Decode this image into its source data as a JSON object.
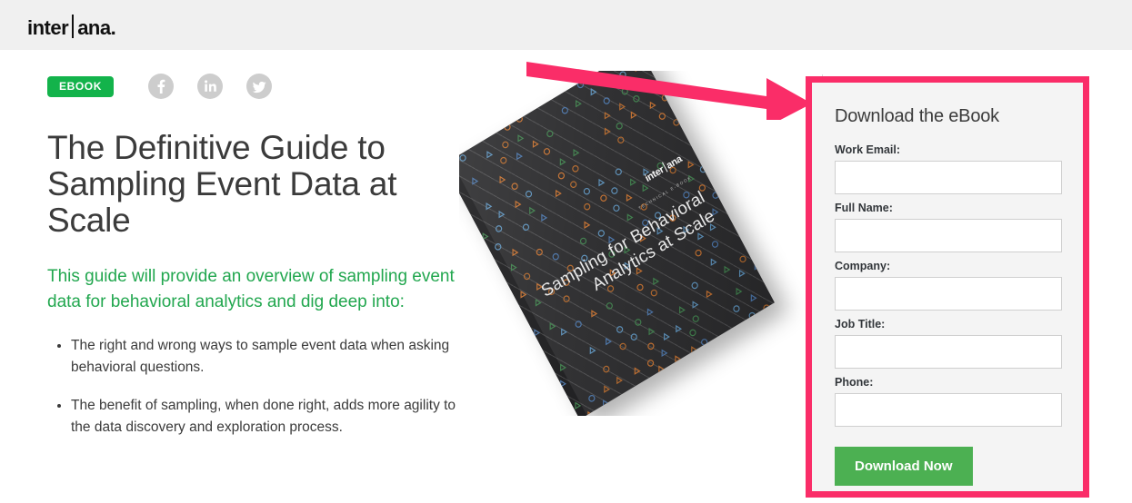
{
  "header": {
    "logo": {
      "part1": "inter",
      "part2": "ana",
      "dot": "."
    }
  },
  "hero": {
    "badge": "EBOOK",
    "social": [
      {
        "name": "facebook-icon",
        "label": "Facebook"
      },
      {
        "name": "linkedin-icon",
        "label": "LinkedIn"
      },
      {
        "name": "twitter-icon",
        "label": "Twitter"
      }
    ],
    "headline": "The Definitive Guide to Sampling Event Data at Scale",
    "subhead": "This guide will provide an overview of sampling event data for behavioral analytics and dig deep into:",
    "bullets": [
      "The right and wrong ways to sample event data when asking behavioral questions.",
      "The benefit of sampling, when done right, adds more agility to the data discovery and exploration process."
    ]
  },
  "book": {
    "logo_part1": "inter",
    "logo_part2": "ana",
    "kicker": "TECHNICAL E-BOOK",
    "title": "Sampling for Behavioral Analytics at Scale"
  },
  "form": {
    "title": "Download the eBook",
    "fields": [
      {
        "label": "Work Email:",
        "name": "work-email-field",
        "value": "",
        "placeholder": ""
      },
      {
        "label": "Full Name:",
        "name": "full-name-field",
        "value": "",
        "placeholder": ""
      },
      {
        "label": "Company:",
        "name": "company-field",
        "value": "",
        "placeholder": ""
      },
      {
        "label": "Job Title:",
        "name": "job-title-field",
        "value": "",
        "placeholder": ""
      },
      {
        "label": "Phone:",
        "name": "phone-field",
        "value": "",
        "placeholder": ""
      }
    ],
    "submit_label": "Download Now"
  },
  "annotation": {
    "arrow": "right-arrow-annotation"
  },
  "colors": {
    "accent_pink": "#fa2d68",
    "badge_green": "#13b34b",
    "text_green": "#22a74f",
    "button_green": "#4cb052",
    "header_bg": "#f0f0f0",
    "panel_bg": "#f4f4f4"
  }
}
